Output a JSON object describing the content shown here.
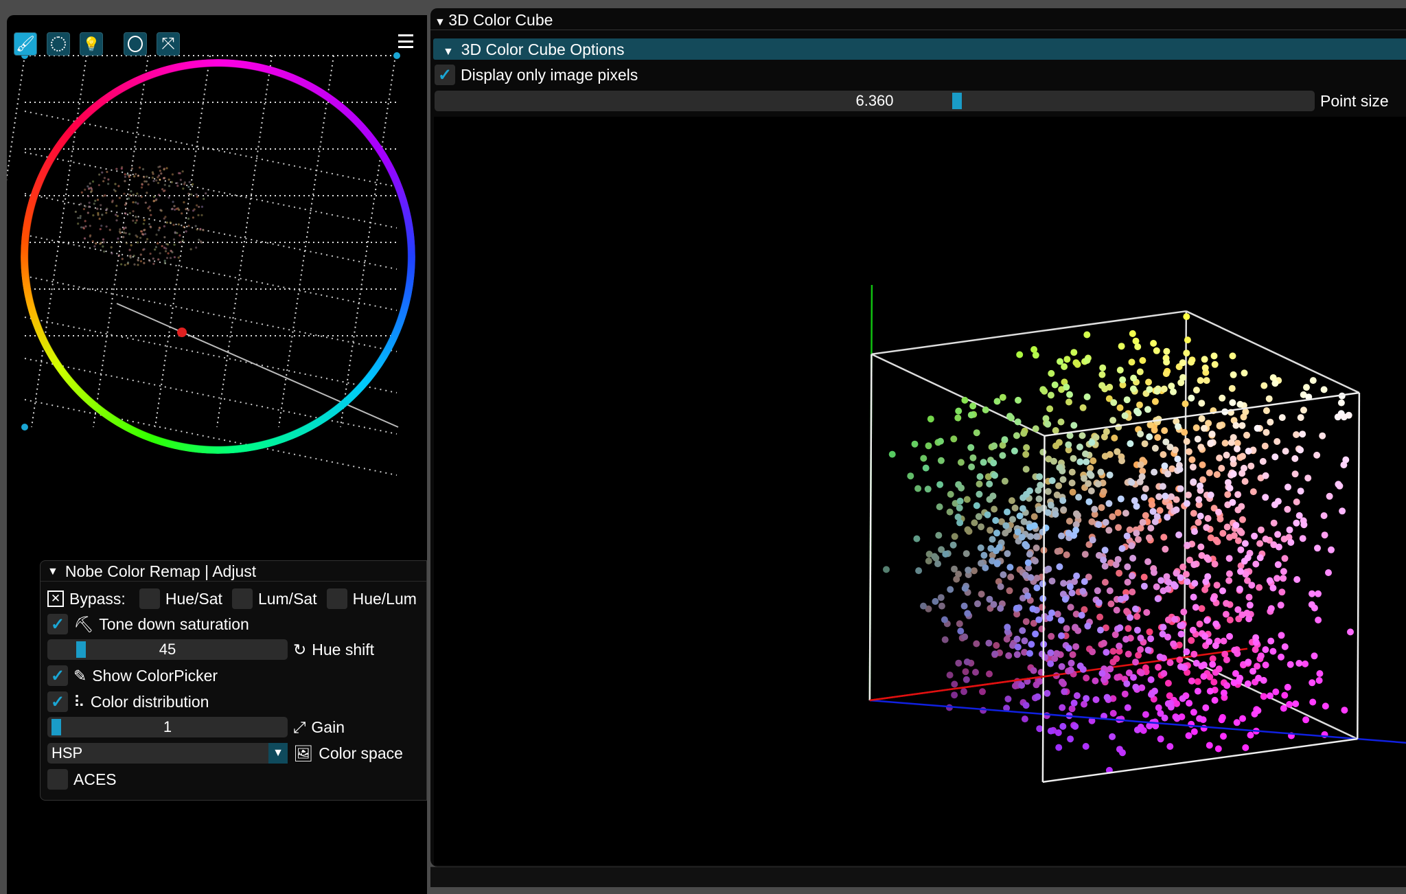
{
  "left_panel": {
    "toolbar": [
      {
        "icon": "brush-icon",
        "active": true
      },
      {
        "icon": "gear-blob-icon",
        "active": false
      },
      {
        "icon": "lightbulb-icon",
        "active": false
      },
      {
        "icon": "circle-icon",
        "active": false
      },
      {
        "icon": "expand-icon",
        "active": false
      }
    ],
    "menu_icon": "hamburger-icon"
  },
  "adjust_panel": {
    "title": "Nobe Color Remap | Adjust",
    "bypass_label": "Bypass:",
    "bypass_options": [
      {
        "label": "Hue/Sat",
        "checked": false
      },
      {
        "label": "Lum/Sat",
        "checked": false
      },
      {
        "label": "Hue/Lum",
        "checked": false
      }
    ],
    "tone_down": {
      "label": "Tone down saturation",
      "checked": true
    },
    "hue_shift": {
      "value": "45",
      "label": "Hue shift"
    },
    "show_colorpicker": {
      "label": "Show ColorPicker",
      "checked": true
    },
    "color_distribution": {
      "label": "Color distribution",
      "checked": true
    },
    "gain": {
      "value": "1",
      "label": "Gain"
    },
    "color_space": {
      "value": "HSP",
      "label": "Color space"
    },
    "aces": {
      "label": "ACES",
      "checked": false
    }
  },
  "cube_window": {
    "title": "3D Color Cube",
    "options_header": "3D Color Cube Options",
    "display_only_image_pixels": {
      "label": "Display only image pixels",
      "checked": true
    },
    "point_size": {
      "value": "6.360",
      "label": "Point size"
    },
    "axis_colors": {
      "x": "#e01010",
      "y": "#10c010",
      "z": "#1020e0"
    }
  },
  "accent": "#1aa6d4"
}
